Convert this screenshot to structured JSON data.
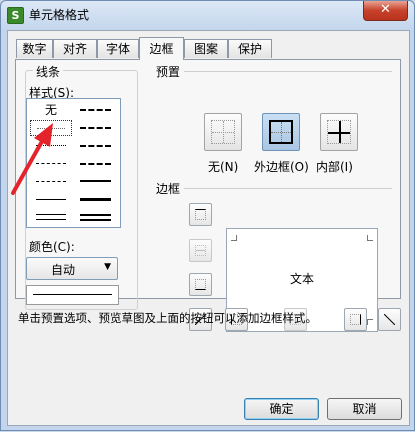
{
  "window": {
    "title": "单元格格式",
    "icon_letter": "S",
    "close_glyph": "✕"
  },
  "tabs": [
    {
      "label": "数字"
    },
    {
      "label": "对齐"
    },
    {
      "label": "字体"
    },
    {
      "label": "边框",
      "active": true
    },
    {
      "label": "图案"
    },
    {
      "label": "保护"
    }
  ],
  "line_group": {
    "title": "线条",
    "style_label": "样式(S):",
    "none_label": "无",
    "color_label": "颜色(C):",
    "color_value": "自动"
  },
  "presets": {
    "title": "预置",
    "items": [
      {
        "label": "无(N)"
      },
      {
        "label": "外边框(O)",
        "active": true
      },
      {
        "label": "内部(I)"
      }
    ]
  },
  "border": {
    "title": "边框",
    "preview_text": "文本"
  },
  "help_text": "单击预置选项、预览草图及上面的按钮可以添加边框样式。",
  "buttons": {
    "ok": "确定",
    "cancel": "取消"
  },
  "colors": {
    "accent": "#3c7fb1",
    "annotation_arrow": "#e5232b",
    "close": "#c7412b"
  }
}
